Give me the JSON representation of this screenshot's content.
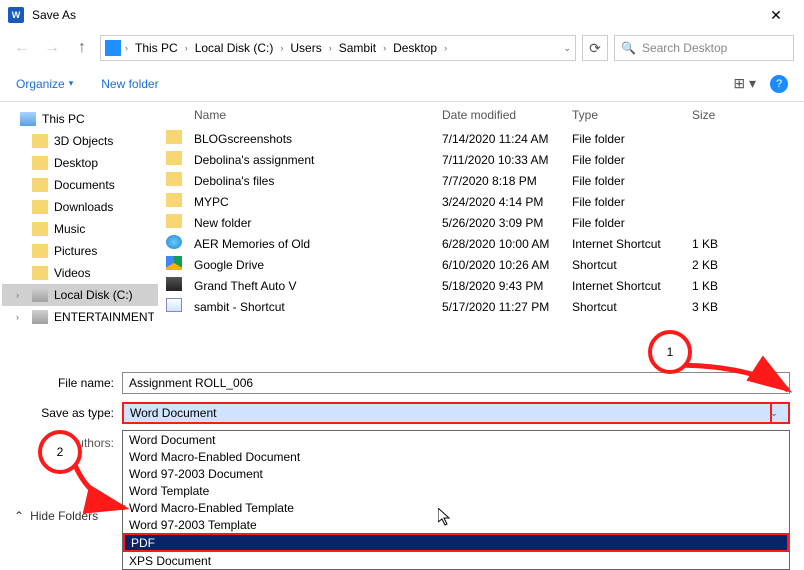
{
  "window": {
    "title": "Save As"
  },
  "breadcrumb": {
    "items": [
      "This PC",
      "Local Disk (C:)",
      "Users",
      "Sambit",
      "Desktop"
    ]
  },
  "search": {
    "placeholder": "Search Desktop"
  },
  "toolbar": {
    "organize": "Organize",
    "new_folder": "New folder"
  },
  "tree": {
    "root": "This PC",
    "items": [
      "3D Objects",
      "Desktop",
      "Documents",
      "Downloads",
      "Music",
      "Pictures",
      "Videos",
      "Local Disk (C:)",
      "ENTERTAINMENT"
    ]
  },
  "columns": {
    "name": "Name",
    "date": "Date modified",
    "type": "Type",
    "size": "Size"
  },
  "files": [
    {
      "icon": "folder",
      "name": "BLOGscreenshots",
      "date": "7/14/2020 11:24 AM",
      "type": "File folder",
      "size": ""
    },
    {
      "icon": "folder",
      "name": "Debolina's assignment",
      "date": "7/11/2020 10:33 AM",
      "type": "File folder",
      "size": ""
    },
    {
      "icon": "folder",
      "name": "Debolina's files",
      "date": "7/7/2020 8:18 PM",
      "type": "File folder",
      "size": ""
    },
    {
      "icon": "folder",
      "name": "MYPC",
      "date": "3/24/2020 4:14 PM",
      "type": "File folder",
      "size": ""
    },
    {
      "icon": "folder",
      "name": "New folder",
      "date": "5/26/2020 3:09 PM",
      "type": "File folder",
      "size": ""
    },
    {
      "icon": "ie",
      "name": "AER Memories of Old",
      "date": "6/28/2020 10:00 AM",
      "type": "Internet Shortcut",
      "size": "1 KB"
    },
    {
      "icon": "gd",
      "name": "Google Drive",
      "date": "6/10/2020 10:26 AM",
      "type": "Shortcut",
      "size": "2 KB"
    },
    {
      "icon": "gta",
      "name": "Grand Theft Auto V",
      "date": "5/18/2020 9:43 PM",
      "type": "Internet Shortcut",
      "size": "1 KB"
    },
    {
      "icon": "short",
      "name": "sambit - Shortcut",
      "date": "5/17/2020 11:27 PM",
      "type": "Shortcut",
      "size": "3 KB"
    }
  ],
  "form": {
    "file_name_label": "File name:",
    "file_name_value": "Assignment ROLL_006",
    "save_as_type_label": "Save as type:",
    "save_as_type_value": "Word Document",
    "authors_label": "Authors:"
  },
  "type_options": [
    "Word Document",
    "Word Macro-Enabled Document",
    "Word 97-2003 Document",
    "Word Template",
    "Word Macro-Enabled Template",
    "Word 97-2003 Template",
    "PDF",
    "XPS Document"
  ],
  "type_selected_index": 6,
  "hide_folders": "Hide Folders",
  "annotations": {
    "step1": "1",
    "step2": "2"
  }
}
